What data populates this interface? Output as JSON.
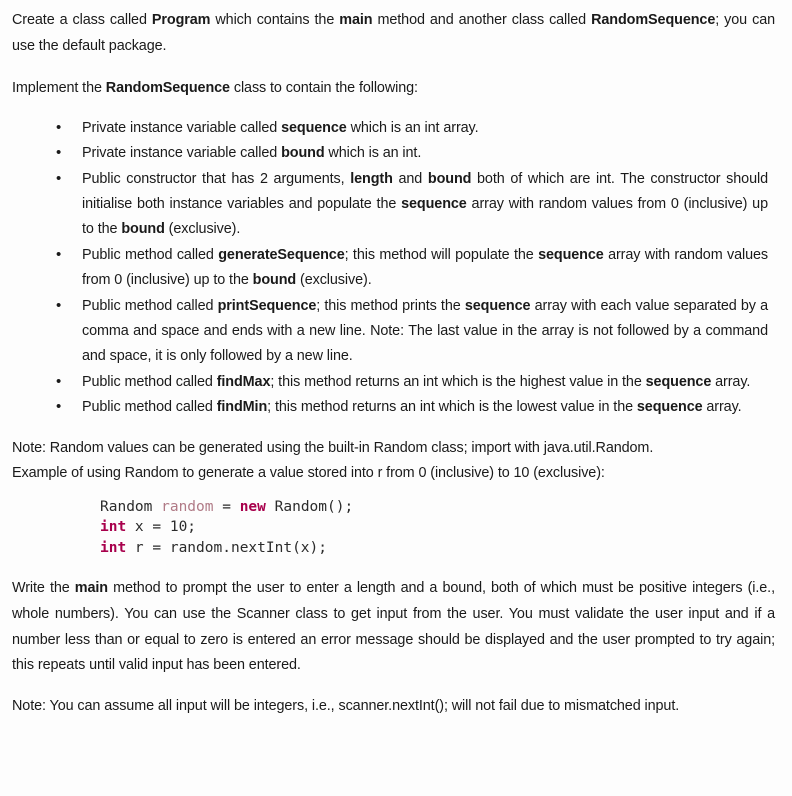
{
  "document": {
    "intro": {
      "segments": [
        {
          "t": "Create a class called ",
          "b": false
        },
        {
          "t": "Program",
          "b": true
        },
        {
          "t": " which contains the ",
          "b": false
        },
        {
          "t": "main",
          "b": true
        },
        {
          "t": " method and another class called ",
          "b": false
        },
        {
          "t": "RandomSequence",
          "b": true
        },
        {
          "t": "; you can use the default package.",
          "b": false
        }
      ],
      "plain": "Create a class called Program which contains the main method and another class called RandomSequence; you can use the default package."
    },
    "implement_line": {
      "segments": [
        {
          "t": "Implement the ",
          "b": false
        },
        {
          "t": "RandomSequence",
          "b": true
        },
        {
          "t": " class to contain the following:",
          "b": false
        }
      ],
      "plain": "Implement the RandomSequence class to contain the following:"
    },
    "requirements": [
      {
        "id": "sequence-field",
        "segments": [
          {
            "t": "Private instance variable called ",
            "b": false
          },
          {
            "t": "sequence",
            "b": true
          },
          {
            "t": " which is an int array.",
            "b": false
          }
        ],
        "plain": "Private instance variable called sequence which is an int array."
      },
      {
        "id": "bound-field",
        "segments": [
          {
            "t": "Private instance variable called ",
            "b": false
          },
          {
            "t": "bound",
            "b": true
          },
          {
            "t": " which is an int.",
            "b": false
          }
        ],
        "plain": "Private instance variable called bound which is an int."
      },
      {
        "id": "constructor",
        "segments": [
          {
            "t": "Public constructor that has 2 arguments, ",
            "b": false
          },
          {
            "t": "length",
            "b": true
          },
          {
            "t": " and ",
            "b": false
          },
          {
            "t": "bound",
            "b": true
          },
          {
            "t": " both of which are int. The constructor should initialise both instance variables and populate the ",
            "b": false
          },
          {
            "t": "sequence",
            "b": true
          },
          {
            "t": " array with random values from 0 (inclusive) up to the ",
            "b": false
          },
          {
            "t": "bound",
            "b": true
          },
          {
            "t": " (exclusive).",
            "b": false
          }
        ],
        "plain": "Public constructor that has 2 arguments, length and bound both of which are int. The constructor should initialise both instance variables and populate the sequence array with random values from 0 (inclusive) up to the bound (exclusive)."
      },
      {
        "id": "generate-sequence",
        "segments": [
          {
            "t": "Public method called ",
            "b": false
          },
          {
            "t": "generateSequence",
            "b": true
          },
          {
            "t": "; this method will populate the ",
            "b": false
          },
          {
            "t": "sequence",
            "b": true
          },
          {
            "t": " array with random values from 0 (inclusive) up to the ",
            "b": false
          },
          {
            "t": "bound",
            "b": true
          },
          {
            "t": " (exclusive).",
            "b": false
          }
        ],
        "plain": "Public method called generateSequence; this method will populate the sequence array with random values from 0 (inclusive) up to the bound (exclusive)."
      },
      {
        "id": "print-sequence",
        "segments": [
          {
            "t": "Public method called ",
            "b": false
          },
          {
            "t": "printSequence",
            "b": true
          },
          {
            "t": "; this method prints the ",
            "b": false
          },
          {
            "t": "sequence",
            "b": true
          },
          {
            "t": " array with each value separated by a comma and space and ends with a new line. Note: The last value in the array is not followed by a command and space, it is only followed by a new line.",
            "b": false
          }
        ],
        "plain": "Public method called printSequence; this method prints the sequence array with each value separated by a comma and space and ends with a new line. Note: The last value in the array is not followed by a command and space, it is only followed by a new line."
      },
      {
        "id": "find-max",
        "segments": [
          {
            "t": "Public method called ",
            "b": false
          },
          {
            "t": "findMax",
            "b": true
          },
          {
            "t": "; this method returns an int which is the highest value in the ",
            "b": false
          },
          {
            "t": "sequence",
            "b": true
          },
          {
            "t": " array.",
            "b": false
          }
        ],
        "plain": "Public method called findMax; this method returns an int which is the highest value in the sequence array."
      },
      {
        "id": "find-min",
        "segments": [
          {
            "t": "Public method called ",
            "b": false
          },
          {
            "t": "findMin",
            "b": true
          },
          {
            "t": "; this method returns an int which is the lowest value in the ",
            "b": false
          },
          {
            "t": "sequence",
            "b": true
          },
          {
            "t": " array.",
            "b": false
          }
        ],
        "plain": "Public method called findMin; this method returns an int which is the lowest value in the sequence array."
      }
    ],
    "note_random": {
      "line1": "Note: Random values can be generated using the built-in Random class; import with java.util.Random.",
      "line2": "Example of using Random to generate a value stored into r from 0 (inclusive) to 10 (exclusive):"
    },
    "code_block": {
      "language": "java",
      "lines": [
        [
          {
            "t": "Random ",
            "c": "plain"
          },
          {
            "t": "random",
            "c": "var"
          },
          {
            "t": " = ",
            "c": "plain"
          },
          {
            "t": "new",
            "c": "kw"
          },
          {
            "t": " Random();",
            "c": "plain"
          }
        ],
        [
          {
            "t": "int",
            "c": "kw"
          },
          {
            "t": " x = 10;",
            "c": "plain"
          }
        ],
        [
          {
            "t": "int",
            "c": "kw"
          },
          {
            "t": " r = random.nextInt(x);",
            "c": "plain"
          }
        ]
      ],
      "plain": "Random random = new Random();\nint x = 10;\nint r = random.nextInt(x);"
    },
    "main_method_para": {
      "segments": [
        {
          "t": "Write the ",
          "b": false
        },
        {
          "t": "main",
          "b": true
        },
        {
          "t": " method to prompt the user to enter a length and a bound, both of which must be positive integers (i.e., whole numbers). You can use the Scanner class to get input from the user. You must validate the user input and if a number less than or equal to zero is entered an error message should be displayed and the user prompted to try again; this repeats until valid input has been entered.",
          "b": false
        }
      ],
      "plain": "Write the main method to prompt the user to enter a length and a bound, both of which must be positive integers (i.e., whole numbers). You can use the Scanner class to get input from the user. You must validate the user input and if a number less than or equal to zero is entered an error message should be displayed and the user prompted to try again; this repeats until valid input has been entered."
    },
    "note_input": {
      "plain": "Note: You can assume all input will be integers, i.e., scanner.nextInt(); will not fail due to mismatched input."
    },
    "colors": {
      "text": "#1a1a1a",
      "background": "#fdfdfd",
      "code_keyword": "#a8004c",
      "code_variable": "#b07a86",
      "code_plain": "#2b2b2b"
    }
  }
}
